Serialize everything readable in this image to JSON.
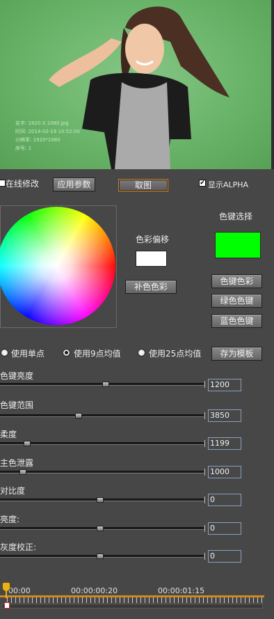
{
  "preview": {
    "meta": [
      "名字: 1920 X 1080.jpg",
      "时间: 2014-02-19 10:52:00",
      "分辨率: 1920*1080",
      "序号: 1"
    ]
  },
  "toolbar": {
    "online_edit_label": "在线修改",
    "online_edit_checked": false,
    "apply_params_label": "应用参数",
    "pick_label": "取图",
    "show_alpha_label": "显示ALPHA",
    "show_alpha_checked": true
  },
  "color_key": {
    "title": "色键选择",
    "key_color": "#00ff00",
    "offset_title": "色彩偏移",
    "offset_color": "#ffffff",
    "complement_label": "补色色彩",
    "key_color_btn": "色键色彩",
    "green_key_btn": "绿色色键",
    "blue_key_btn": "蓝色色键"
  },
  "sampling": {
    "options": [
      "使用单点",
      "使用9点均值",
      "使用25点均值"
    ],
    "selected": 1,
    "save_template_label": "存为模板"
  },
  "sliders": [
    {
      "label": "色键亮度",
      "value": "1200",
      "position": 0.52
    },
    {
      "label": "色键范围",
      "value": "3850",
      "position": 0.38
    },
    {
      "label": "柔度",
      "value": "1199",
      "position": 0.12
    },
    {
      "label": "主色泄露",
      "value": "1000",
      "position": 0.1
    },
    {
      "label": "对比度",
      "value": "0",
      "position": 0.49
    },
    {
      "label": "亮度:",
      "value": "0",
      "position": 0.49
    },
    {
      "label": "灰度校正:",
      "value": "0",
      "position": 0.49
    }
  ],
  "timeline": {
    "times": [
      "00:00",
      "00:00:00:20",
      "00:00:01:15"
    ]
  }
}
